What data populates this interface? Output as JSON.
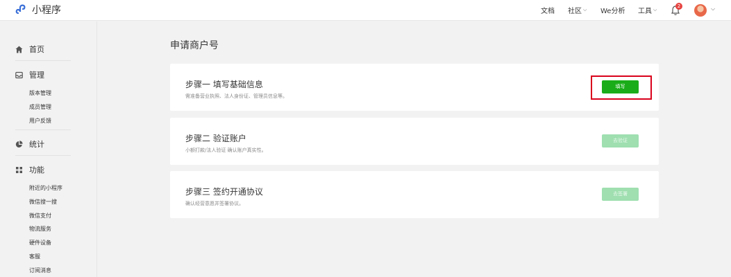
{
  "header": {
    "logo_text": "小程序",
    "nav": [
      {
        "label": "文档",
        "has_dropdown": false
      },
      {
        "label": "社区",
        "has_dropdown": true
      },
      {
        "label": "We分析",
        "has_dropdown": false
      },
      {
        "label": "工具",
        "has_dropdown": true
      }
    ],
    "notification_count": "2",
    "brand_color": "#1aad19"
  },
  "sidebar": {
    "groups": [
      {
        "label": "首页",
        "icon": "home-icon",
        "items": []
      },
      {
        "label": "管理",
        "icon": "inbox-icon",
        "items": [
          "版本管理",
          "成员管理",
          "用户反馈"
        ]
      },
      {
        "label": "统计",
        "icon": "pie-chart-icon",
        "items": []
      },
      {
        "label": "功能",
        "icon": "grid-icon",
        "items": [
          "附近的小程序",
          "微信搜一搜",
          "微信支付",
          "物流服务",
          "硬件设备",
          "客服",
          "订阅消息"
        ]
      }
    ]
  },
  "main": {
    "title": "申请商户号",
    "steps": [
      {
        "title": "步骤一 填写基础信息",
        "desc": "需准备营业执照、法人身份证、管理员信息等。",
        "button": "填写",
        "enabled": true,
        "highlighted": true
      },
      {
        "title": "步骤二 验证账户",
        "desc": "小额打款/法人验证 确认账户真实性。",
        "button": "去验证",
        "enabled": false,
        "highlighted": false
      },
      {
        "title": "步骤三 签约开通协议",
        "desc": "确认经营意愿并签署协议。",
        "button": "去签署",
        "enabled": false,
        "highlighted": false
      }
    ]
  }
}
